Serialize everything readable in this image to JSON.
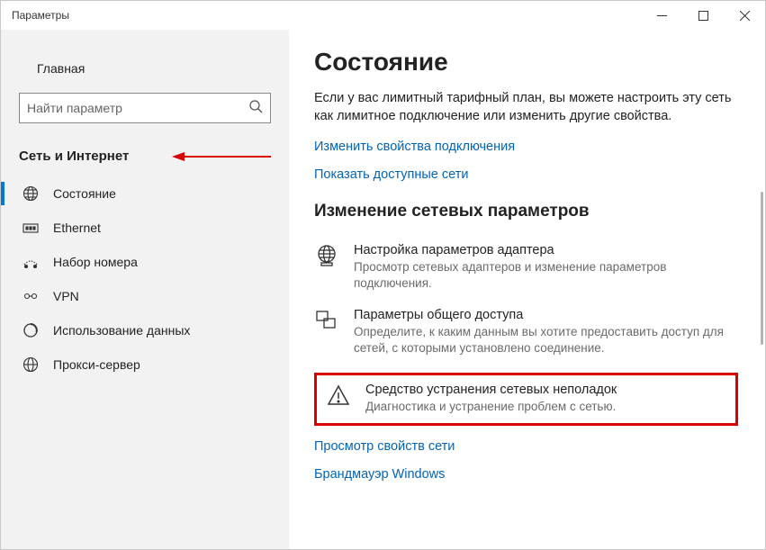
{
  "window": {
    "title": "Параметры"
  },
  "sidebar": {
    "home": "Главная",
    "search_placeholder": "Найти параметр",
    "category": "Сеть и Интернет",
    "items": [
      {
        "label": "Состояние",
        "icon": "globe-grid-icon"
      },
      {
        "label": "Ethernet",
        "icon": "ethernet-icon"
      },
      {
        "label": "Набор номера",
        "icon": "dialup-icon"
      },
      {
        "label": "VPN",
        "icon": "vpn-icon"
      },
      {
        "label": "Использование данных",
        "icon": "data-usage-icon"
      },
      {
        "label": "Прокси-сервер",
        "icon": "globe-icon"
      }
    ]
  },
  "main": {
    "heading": "Состояние",
    "intro": "Если у вас лимитный тарифный план, вы можете настроить эту сеть как лимитное подключение или изменить другие свойства.",
    "link_props": "Изменить свойства подключения",
    "link_networks": "Показать доступные сети",
    "subheading": "Изменение сетевых параметров",
    "rows": [
      {
        "title": "Настройка параметров адаптера",
        "desc": "Просмотр сетевых адаптеров и изменение параметров подключения."
      },
      {
        "title": "Параметры общего доступа",
        "desc": "Определите, к каким данным вы хотите предоставить доступ для сетей, с которыми установлено соединение."
      },
      {
        "title": "Средство устранения сетевых неполадок",
        "desc": "Диагностика и устранение проблем с сетью."
      }
    ],
    "link_netprops": "Просмотр свойств сети",
    "link_firewall": "Брандмауэр Windows"
  }
}
